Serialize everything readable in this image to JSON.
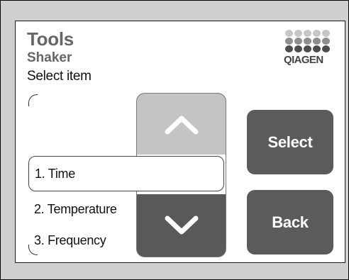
{
  "header": {
    "title": "Tools",
    "subtitle": "Shaker",
    "prompt": "Select item"
  },
  "logo": {
    "text": "QIAGEN",
    "dot_rows": [
      [
        "l",
        "l",
        "l",
        "l",
        "l"
      ],
      [
        "m",
        "m",
        "m",
        "m",
        "m"
      ],
      [
        "d",
        "d",
        "d",
        "d",
        "d"
      ]
    ]
  },
  "list": {
    "items": [
      {
        "label": "1. Time",
        "selected": true
      },
      {
        "label": "2. Temperature",
        "selected": false
      },
      {
        "label": "3. Frequency",
        "selected": false
      }
    ]
  },
  "scroll": {
    "up_icon": "chevron-up-icon",
    "down_icon": "chevron-down-icon"
  },
  "buttons": {
    "select_label": "Select",
    "back_label": "Back"
  },
  "colors": {
    "button_bg": "#5b5b5b",
    "scroll_up_bg": "#c4c4c4",
    "header_text": "#666666"
  }
}
